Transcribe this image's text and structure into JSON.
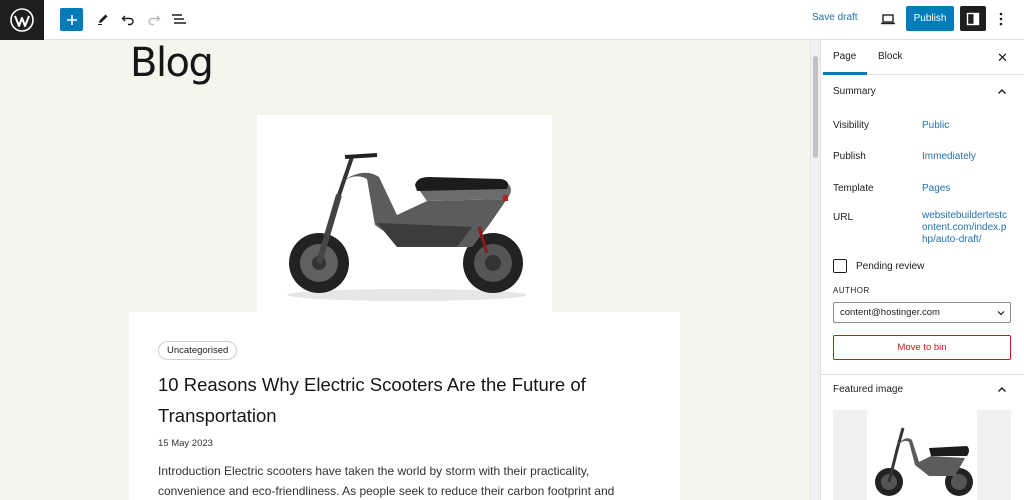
{
  "toolbar": {
    "save_draft": "Save draft",
    "publish": "Publish"
  },
  "canvas": {
    "page_title": "Blog",
    "post": {
      "category": "Uncategorised",
      "title": "10 Reasons Why Electric Scooters Are the Future of Transportation",
      "date": "15 May 2023",
      "excerpt": "Introduction Electric scooters have taken the world by storm with their practicality, convenience and eco-friendliness. As people seek to reduce their carbon footprint and"
    }
  },
  "sidebar": {
    "tabs": [
      "Page",
      "Block"
    ],
    "active_tab": "Page",
    "summary": {
      "heading": "Summary",
      "rows": [
        {
          "label": "Visibility",
          "value": "Public"
        },
        {
          "label": "Publish",
          "value": "Immediately"
        },
        {
          "label": "Template",
          "value": "Pages"
        },
        {
          "label": "URL",
          "value": "websitebuildertestcontent.com/index.php/auto-draft/"
        }
      ],
      "pending_review": "Pending review",
      "author_label": "AUTHOR",
      "author_value": "content@hostinger.com",
      "move_to_bin": "Move to bin"
    },
    "featured_image": {
      "heading": "Featured image"
    }
  },
  "colors": {
    "accent": "#007cba",
    "link": "#2271b1",
    "danger": "#cc1818",
    "canvas_bg": "#f5f5ed",
    "dark": "#1e1e1e"
  },
  "icons": {
    "logo": "wordpress-logo-icon",
    "add": "plus-icon",
    "tools": "pencil-icon",
    "undo": "undo-icon",
    "redo": "redo-icon",
    "outline": "list-view-icon",
    "preview": "laptop-icon",
    "settings": "sidebar-panel-icon",
    "more": "vertical-ellipsis-icon",
    "close": "close-icon",
    "collapse": "chevron-up-icon",
    "select": "chevron-down-icon"
  }
}
